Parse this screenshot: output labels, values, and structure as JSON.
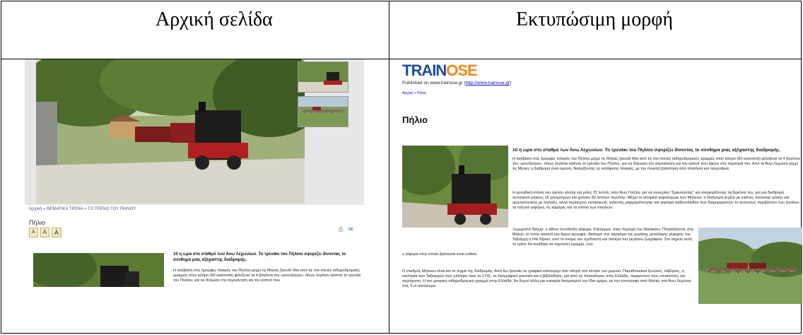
{
  "headers": {
    "left": "Αρχική σελίδα",
    "right": "Εκτυπώσιμη μορφή"
  },
  "left_page": {
    "breadcrumb": "Αρχική » ΘΕΜΑΤΙΚΑ ΤΡΕΝΑ » ΤΟ ΤΡΕΝΟ ΤΟΥ ΠΗΛΙΟΥ",
    "title": "Πήλιο",
    "size_buttons": [
      "A",
      "A",
      "A"
    ],
    "article_heading": "10 η ώρα στο σταθμό των Άνω Λεχωνίων. Το τρενάκι του Πηλίου σφυρίζει δίνοντας το σύνθημα μιας αξέχαστης διαδρομής.",
    "article_text": "Η ανάβαση στις όμορφες πλαγιές του Πηλίου μέχρι τις Μηλιές ξεκινά! Μια από τις πιο στενές σιδηροδρομικές γραμμές στον κόσμο (60 εκατοστά) φιλοξενεί τα 4 βαγόνια του «μουτζούρη», όπως λεγόταν κάποτε το τρενάκι του Πηλίου, για να δηλώσει την ατμοκίνηση και τον καπνό που"
  },
  "right_page": {
    "logo_main": "TRAIN",
    "logo_accent": "OSE",
    "published_prefix": "Published on www.trainose.gr (",
    "published_link": "http://www.trainose.gr",
    "published_suffix": ")",
    "breadcrumb": "Αρχική > Πήλιο",
    "title": "Πήλιο",
    "heading": "10 η ώρα στο σταθμό των Άνω Λεχωνίων. Το τρενάκι του Πηλίου σφυρίζει δίνοντας το σύνθημα μιας αξέχαστης διαδρομής.",
    "p1": "Η ανάβαση στις όμορφες πλαγιές του Πηλίου μέχρι τις Μηλιές ξεκινά! Μια από τις πιο στενές σιδηροδρομικές γραμμές στον κόσμο (60 εκατοστά) φιλοξενεί τα 4 βαγόνια του «μουτζούρη», όπως λεγόταν κάποτε το τρενάκι του Πηλίου, για να δηλώσει την ατμοκίνηση και τον καπνό που άφηνε στο πέρασμά του. Από τα Άνω Λεχώνια μέχρι τις Μηλιές η διαδρομή είναι ορεινή, διασχίζοντας τις κατάφυτες πλαγιές, με την ποικιλή βλάστηση από πλατάνια και πουρνάρια.",
    "p2": "Η μοναδική στάση του τρένου γίνεται για μόλις 15 λεπτά, στην Άνω Γατζέα, για να συνεχίσει \"ξεφυσώντας\" και ανηφορίζοντας τα βαγόνια του, για μια διαδρομή συνολικού μήκους 15 χιλιομέτρων και χρόνου 90 λεπτών περίπου. Μέχρι το ιστορικό κεφαλοχώρι των Μηλεών, η διαδρομή γεμίζει με εικόνες πλούσιας φύσης και αρχιτεκτονικής με παλαιές, αλλά περίτεχνες κατασκευές λαξευτής μαρμαρόπετρας και γεφύρια ασβεστόλιθου που διαμορφώνουν το αυτοτελές περιβάλλον των ζουλίων, τα τοξωτά γεφύρια, τις καμάρες και τα σπίτια των σπηλιών.",
    "p3": "Ξεχωριστό δείγμα, η λίθινη πεντάτοξη γέφυρα, Καλόρεμα, στην περιοχή του Μαλακίου. Πλησιάζοντας στις Μηλιές το τοπίο αποκτά μια άγρια ομορφιά, ιδιαίτερο στο πέρασμα της μεγάλης μεταλλικής γέφυρας του Ταξιάρχη ή Ντε Κίρικο, από το όνομα του σχεδιαστή και πατέρα του μεγάλου ζωγράφου. Στο σημείο αυτό, το τρένο θα κινήθηκε σε καμπύλη γραμμή, ενώ",
    "p4": "η γέφυρα στην οποία βρίσκεται είναι ευθεία.",
    "p5": "Ο σταθμός Μηλεών είναι και το τέρμα της διαδρομής. Από δω ξεκινάει το γραφικό καλντερίμι που οδηγεί στο κέντρο του χωριού. Παραδοσιακοί ξενώνες, ταβέρνες, η εκκλησία των Ταξιαρχών που χτίστηκε πριν το 1741, το λαογραφικό μουσείο και η βιβλιοθήκη, μια από τις παλαιότερες στην Ελλάδα, περιμένουν τους επισκέπτες για περιήγηση. Η πιο γραφική σιδηροδρομική γραμμή στην Ελλάδα, θα δεχτεί άλλη μια ευκαιρία θαυμασμού την ίδια ημέρα, με την επιστροφή από Μηλιές στα Άνω Λεχώνια στις 3 το απόγευμα."
  }
}
